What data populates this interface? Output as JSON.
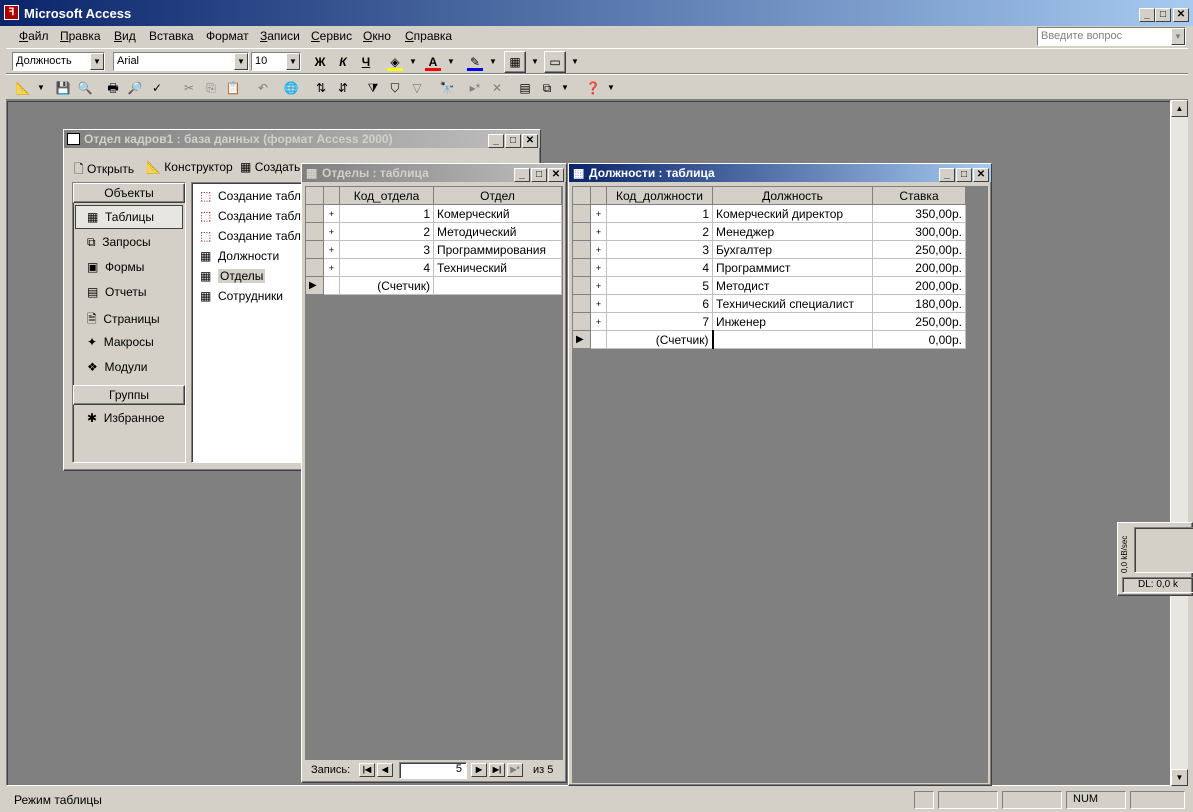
{
  "app": {
    "title": "Microsoft Access"
  },
  "menu": [
    {
      "label": "Файл",
      "u": "Ф",
      "rest": "айл"
    },
    {
      "label": "Правка",
      "u": "П",
      "rest": "равка"
    },
    {
      "label": "Вид",
      "u": "В",
      "rest": "ид"
    },
    {
      "label": "Вставка",
      "u": "",
      "rest": "Вставка"
    },
    {
      "label": "Формат",
      "u": "",
      "rest": "Формат"
    },
    {
      "label": "Записи",
      "u": "З",
      "rest": "аписи"
    },
    {
      "label": "Сервис",
      "u": "С",
      "rest": "ервис"
    },
    {
      "label": "Окно",
      "u": "О",
      "rest": "кно"
    },
    {
      "label": "Справка",
      "u": "С",
      "rest": "правка"
    }
  ],
  "help_box": {
    "placeholder": "Введите вопрос"
  },
  "format_toolbar": {
    "field": "Должность",
    "font": "Arial",
    "size": "10",
    "bold": "Ж",
    "italic": "К",
    "underline": "Ч",
    "colors": {
      "fill": "#ffff00",
      "font": "#ff0000",
      "line": "#0000ff"
    }
  },
  "dbwin": {
    "title": "Отдел кадров1 : база данных (формат Access 2000)",
    "toolbar": {
      "open": "Открыть",
      "design": "Конструктор",
      "create": "Создать"
    },
    "objects_header": "Объекты",
    "objects": [
      {
        "label": "Таблицы",
        "icon": "table-icon"
      },
      {
        "label": "Запросы",
        "icon": "query-icon"
      },
      {
        "label": "Формы",
        "icon": "form-icon"
      },
      {
        "label": "Отчеты",
        "icon": "report-icon"
      },
      {
        "label": "Страницы",
        "icon": "page-icon"
      },
      {
        "label": "Макросы",
        "icon": "macro-icon"
      },
      {
        "label": "Модули",
        "icon": "module-icon"
      }
    ],
    "groups_header": "Группы",
    "groups": [
      {
        "label": "Избранное",
        "icon": "favorites-icon"
      }
    ],
    "items": [
      {
        "label": "Создание табл",
        "icon": "wizard-icon"
      },
      {
        "label": "Создание табл",
        "icon": "wizard-icon"
      },
      {
        "label": "Создание табл",
        "icon": "wizard-icon"
      },
      {
        "label": "Должности",
        "icon": "table-icon"
      },
      {
        "label": "Отделы",
        "icon": "table-icon"
      },
      {
        "label": "Сотрудники",
        "icon": "table-icon"
      }
    ]
  },
  "otdely": {
    "title": "Отделы : таблица",
    "headers": [
      "Код_отдела",
      "Отдел"
    ],
    "rows": [
      [
        "1",
        "Комерческий"
      ],
      [
        "2",
        "Методический"
      ],
      [
        "3",
        "Программирования"
      ],
      [
        "4",
        "Технический"
      ]
    ],
    "new_row": [
      "(Счетчик)",
      ""
    ],
    "nav": {
      "label": "Запись:",
      "current": "5",
      "of": "из 5"
    }
  },
  "dolzhnosti": {
    "title": "Должности : таблица",
    "headers": [
      "Код_должности",
      "Должность",
      "Ставка"
    ],
    "rows": [
      [
        "1",
        "Комерческий директор",
        "350,00р."
      ],
      [
        "2",
        "Менеджер",
        "300,00р."
      ],
      [
        "3",
        "Бухгалтер",
        "250,00р."
      ],
      [
        "4",
        "Программист",
        "200,00р."
      ],
      [
        "5",
        "Методист",
        "200,00р."
      ],
      [
        "6",
        "Технический специалист",
        "180,00р."
      ],
      [
        "7",
        "Инженер",
        "250,00р."
      ]
    ],
    "new_row": [
      "(Счетчик)",
      "",
      "0,00р."
    ]
  },
  "meter": {
    "axis": "0,0 kB/sec",
    "dl": "DL: 0,0 k"
  },
  "status": {
    "text": "Режим таблицы",
    "num": "NUM"
  }
}
